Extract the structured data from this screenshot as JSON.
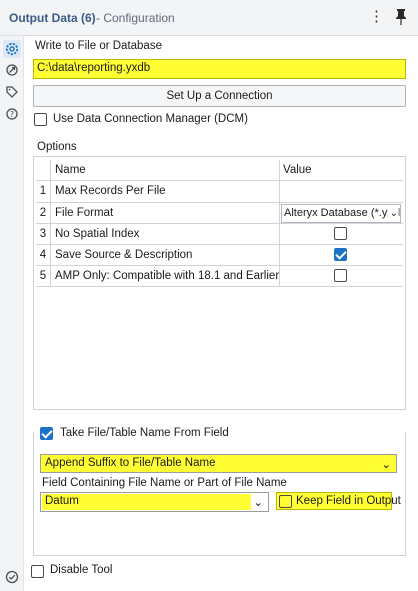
{
  "header": {
    "title": "Output Data (6)",
    "subtitle": "- Configuration",
    "menu_icon": "kebab-menu-icon",
    "pin_icon": "pin-icon"
  },
  "rail": {
    "items": [
      {
        "icon": "gear-icon",
        "active": true
      },
      {
        "icon": "annotation-icon",
        "active": false
      },
      {
        "icon": "tag-icon",
        "active": false
      },
      {
        "icon": "help-icon",
        "active": false
      }
    ],
    "bottom_icon": "check-circle-icon"
  },
  "write": {
    "label": "Write to File or Database",
    "value": "C:\\data\\reporting.yxdb",
    "setup_button": "Set Up a Connection"
  },
  "dcm": {
    "label": "Use Data Connection Manager (DCM)",
    "checked": false
  },
  "options": {
    "label": "Options",
    "columns": [
      "Name",
      "Value"
    ],
    "rows": [
      {
        "num": "1",
        "name": "Max Records Per File",
        "value": "",
        "kind": "text"
      },
      {
        "num": "2",
        "name": "File Format",
        "value": "Alteryx Database (*.yxdb)",
        "kind": "select"
      },
      {
        "num": "3",
        "name": "No Spatial Index",
        "checked": false,
        "kind": "checkbox"
      },
      {
        "num": "4",
        "name": "Save Source & Description",
        "checked": true,
        "kind": "checkbox"
      },
      {
        "num": "5",
        "name": "AMP Only: Compatible with 18.1 and Earlier",
        "checked": false,
        "kind": "checkbox"
      }
    ]
  },
  "take_name": {
    "label": "Take File/Table Name From Field",
    "checked": true,
    "mode_value": "Append Suffix to File/Table Name",
    "field_label": "Field Containing File Name or Part of File Name",
    "field_value": "Datum",
    "keep_label": "Keep Field in Output",
    "keep_checked": false
  },
  "disable": {
    "label": "Disable Tool",
    "checked": false
  },
  "colors": {
    "highlight": "#ffff33",
    "accent": "#1a73c9",
    "title": "#3b5a85"
  }
}
